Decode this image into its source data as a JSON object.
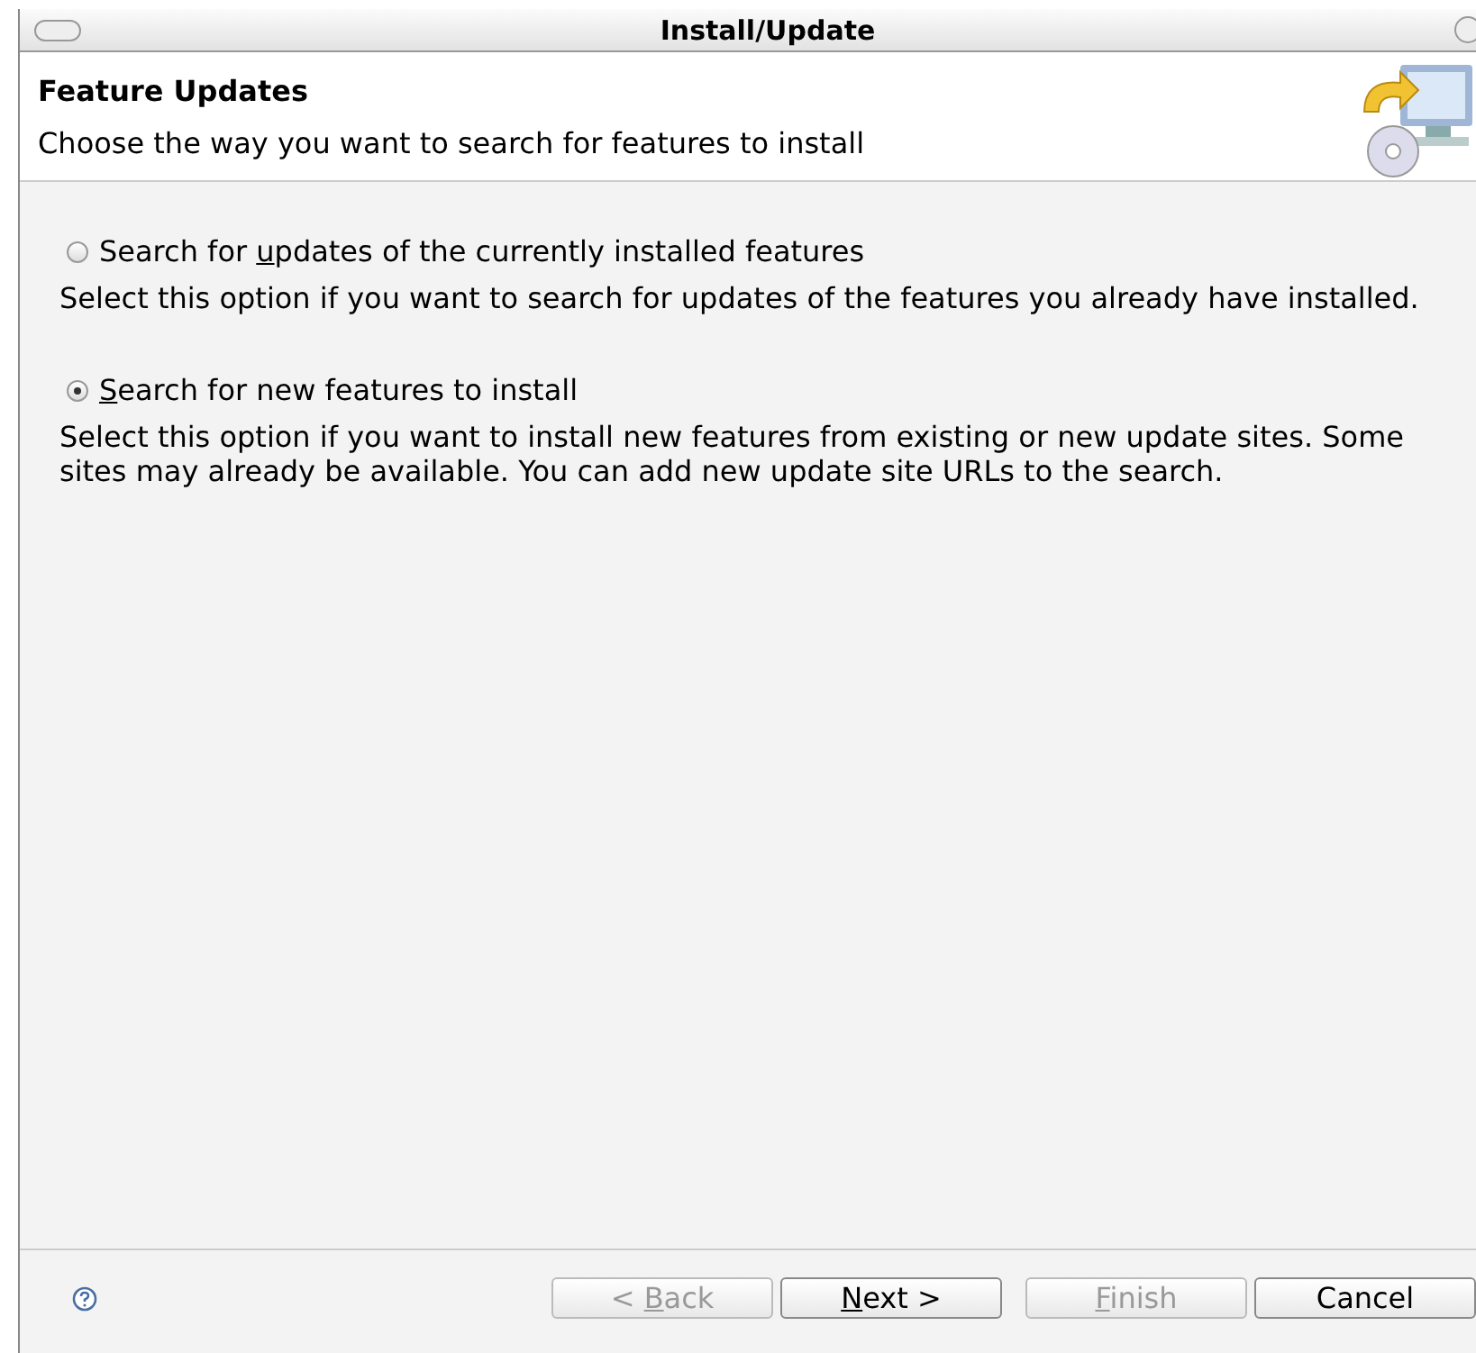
{
  "window": {
    "title": "Install/Update"
  },
  "header": {
    "title": "Feature Updates",
    "description": "Choose the way you want to search for features to install"
  },
  "options": [
    {
      "label_before": "Search for ",
      "mnemonic": "u",
      "label_after": "pdates of the currently installed features",
      "selected": false,
      "description": "Select this option if you want to search for updates of the features you already have installed."
    },
    {
      "mnemonic": "S",
      "label_after": "earch for new features to install",
      "selected": true,
      "description": "Select this option if you want to install new features from existing or new update sites. Some sites may already be available. You can add new update site URLs to the search."
    }
  ],
  "buttons": [
    {
      "label_before": "< ",
      "mnemonic": "B",
      "label_after": "ack",
      "disabled": true
    },
    {
      "mnemonic": "N",
      "label_after": "ext >",
      "disabled": false
    },
    {
      "mnemonic": "F",
      "label_after": "inish",
      "disabled": true
    },
    {
      "label_before": "Cancel",
      "disabled": false
    }
  ]
}
